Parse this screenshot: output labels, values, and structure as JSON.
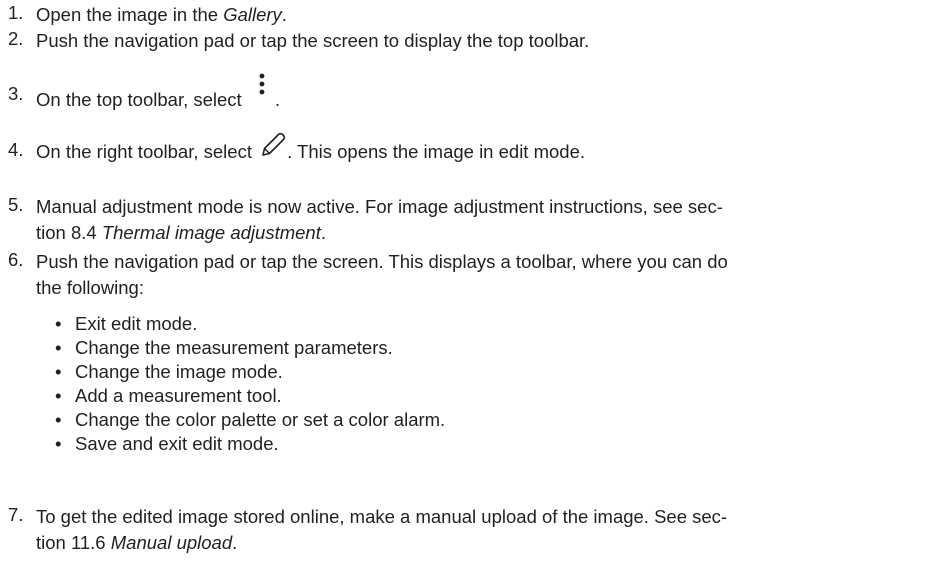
{
  "steps": [
    {
      "num": "1.",
      "pre": "Open the image in the ",
      "em": "Gallery",
      "post": "."
    },
    {
      "num": "2.",
      "text": "Push the navigation pad or tap the screen to display the top toolbar."
    },
    {
      "num": "3.",
      "pre": "On the top toolbar, select ",
      "post": ".",
      "icon": "more-vertical-icon"
    },
    {
      "num": "4.",
      "pre": "On the right toolbar, select ",
      "post": ". This opens the image in edit mode.",
      "icon": "pencil-edit-icon"
    },
    {
      "num": "5.",
      "line1": "Manual adjustment mode is now active. For image adjustment instructions, see sec-",
      "line2_pre": "tion 8.4 ",
      "line2_em": "Thermal image adjustment",
      "line2_post": "."
    },
    {
      "num": "6.",
      "line1": "Push the navigation pad or tap the screen. This displays a toolbar, where you can do",
      "line2": "the following:",
      "bullets": [
        "Exit edit mode.",
        "Change the measurement parameters.",
        "Change the image mode.",
        "Add a measurement tool.",
        "Change the color palette or set a color alarm.",
        "Save and exit edit mode."
      ]
    },
    {
      "num": "7.",
      "line1": "To get the edited image stored online, make a manual upload of the image. See sec-",
      "line2_pre": "tion 11.6 ",
      "line2_em": "Manual upload",
      "line2_post": "."
    }
  ],
  "bullet_glyph": "•"
}
